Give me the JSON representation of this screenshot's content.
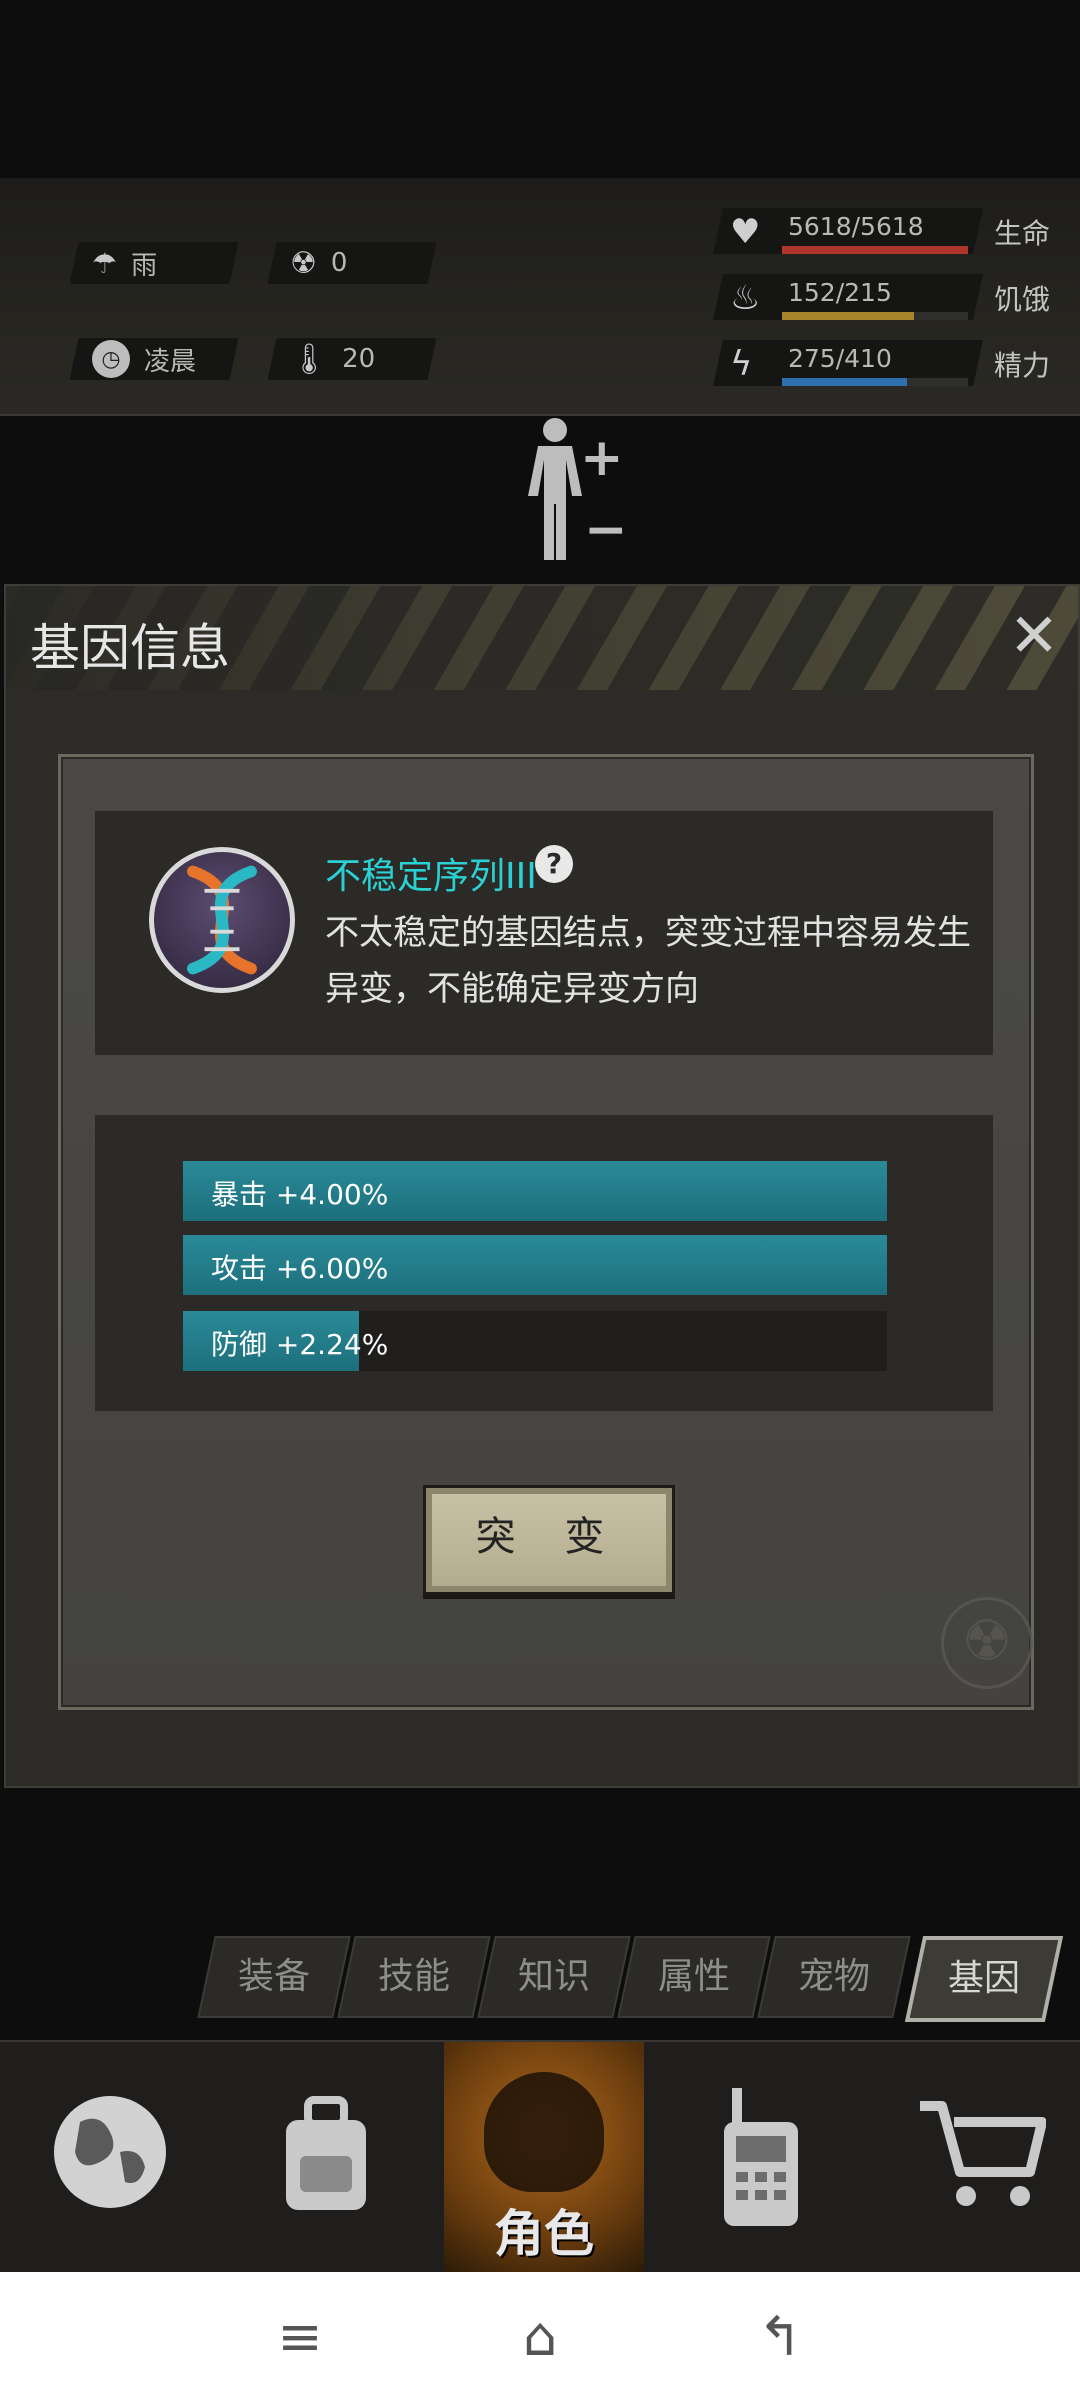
{
  "status": {
    "weather": "雨",
    "radiation": "0",
    "time_of_day": "凌晨",
    "temperature": "20",
    "stats": [
      {
        "icon": "heart-pulse-icon",
        "value": "5618/5618",
        "label": "生命",
        "fill": 1.0,
        "color": "#b0352c"
      },
      {
        "icon": "stomach-icon",
        "value": "152/215",
        "label": "饥饿",
        "fill": 0.707,
        "color": "#a8842c"
      },
      {
        "icon": "lightning-icon",
        "value": "275/410",
        "label": "精力",
        "fill": 0.671,
        "color": "#2f6fb0"
      }
    ]
  },
  "dialog": {
    "title": "基因信息",
    "gene": {
      "name": "不稳定序列III",
      "description": "不太稳定的基因结点，突变过程中容易发生异变，不能确定异变方向"
    },
    "attributes": [
      {
        "text": "暴击 +4.00%",
        "fill": 1.0
      },
      {
        "text": "攻击 +6.00%",
        "fill": 1.0
      },
      {
        "text": "防御 +2.24%",
        "fill": 0.25
      }
    ],
    "mutate_label": "突 变"
  },
  "tabs": [
    "装备",
    "技能",
    "知识",
    "属性",
    "宠物",
    "基因"
  ],
  "active_tab": "基因",
  "bottom_nav": {
    "items": [
      "globe-icon",
      "backpack-icon",
      "role-icon",
      "walkie-talkie-icon",
      "cart-icon"
    ],
    "active_label": "角色"
  },
  "colors": {
    "accent_cyan": "#2ad0d2",
    "bar_teal": "#1d6f7c"
  }
}
